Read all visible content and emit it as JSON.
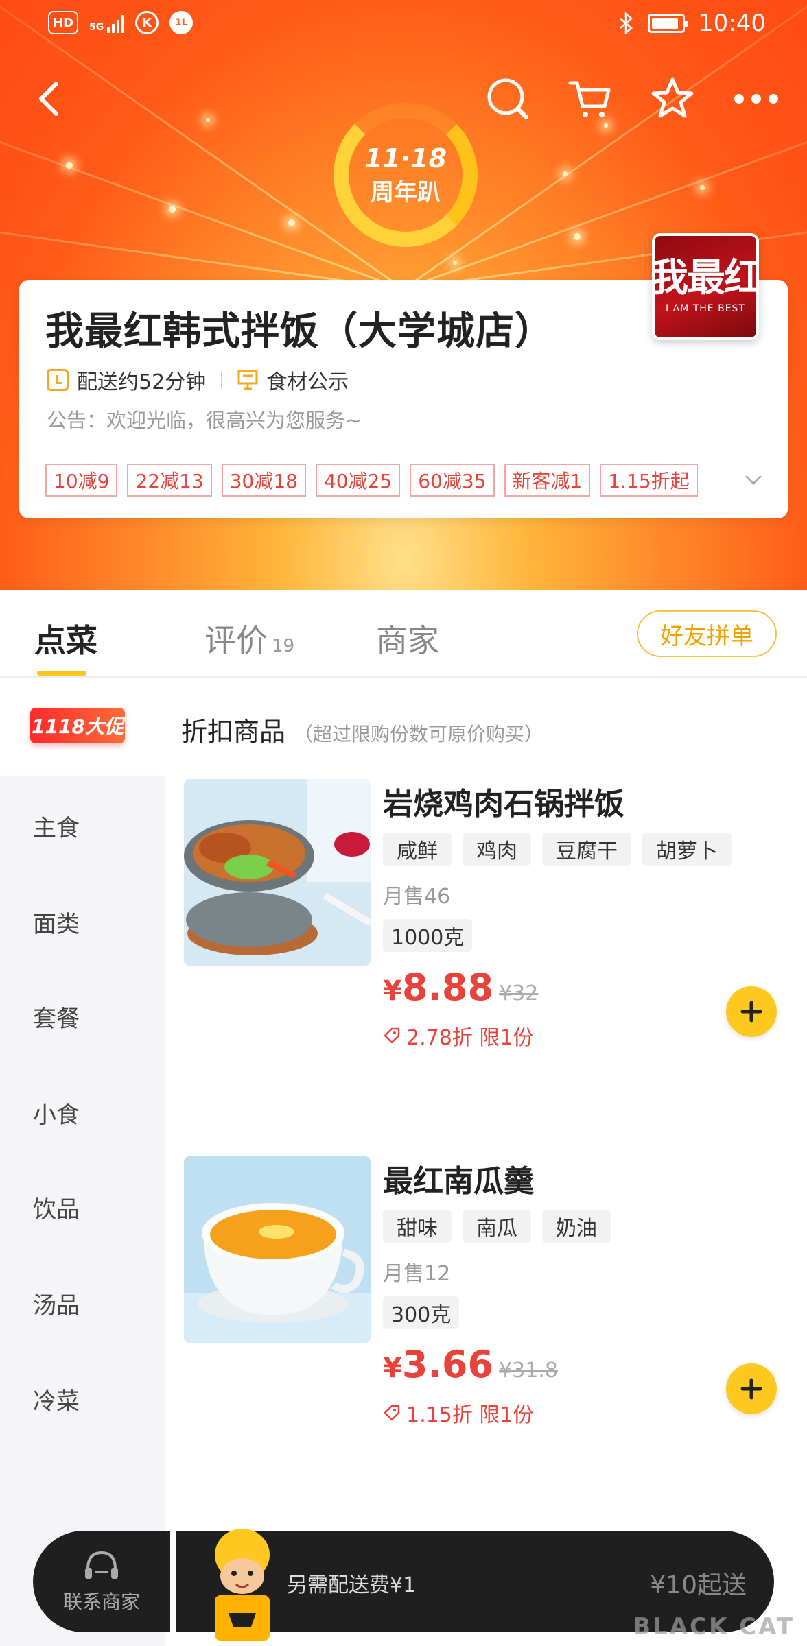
{
  "status_bar": {
    "left_icons": [
      "HD",
      "5G",
      "K",
      "1L"
    ],
    "time": "10:40",
    "battery_level": 0.9
  },
  "header": {
    "icons": [
      "back-icon",
      "search-icon",
      "cart-icon",
      "star-icon",
      "more-icon"
    ],
    "promo_logo_line1": "11·18",
    "promo_logo_line2": "周年趴",
    "colors": {
      "gradient_top": "#ff4a14",
      "gradient_center": "#ffb53a"
    }
  },
  "store": {
    "name": "我最红韩式拌饭（大学城店）",
    "delivery_time": "配送约52分钟",
    "ingredients_label": "食材公示",
    "notice": "公告：欢迎光临，很高兴为您服务~",
    "discount_tags": [
      "10减9",
      "22减13",
      "30减18",
      "40减25",
      "60减35",
      "新客减1",
      "1.15折起"
    ],
    "logo_text": "我最红",
    "logo_subtext": "I AM THE BEST"
  },
  "tabs": {
    "items": [
      {
        "label": "点菜",
        "count": ""
      },
      {
        "label": "评价",
        "count": "19"
      },
      {
        "label": "商家",
        "count": ""
      }
    ],
    "active": "点菜",
    "group_order_label": "好友拼单"
  },
  "promo_section": {
    "badge": "1118大促",
    "title": "折扣商品",
    "subtitle": "（超过限购份数可原价购买）"
  },
  "sidebar": {
    "categories": [
      "主食",
      "面类",
      "套餐",
      "小食",
      "饮品",
      "汤品",
      "冷菜"
    ]
  },
  "products": [
    {
      "name": "岩烧鸡肉石锅拌饭",
      "tags": [
        "咸鲜",
        "鸡肉",
        "豆腐干",
        "胡萝卜"
      ],
      "monthly_sales": "月售46",
      "spec": "1000克",
      "currency": "¥",
      "price": "8.88",
      "original_price": "¥32",
      "discount": "2.78折 限1份"
    },
    {
      "name": "最红南瓜羹",
      "tags": [
        "甜味",
        "南瓜",
        "奶油"
      ],
      "monthly_sales": "月售12",
      "spec": "300克",
      "currency": "¥",
      "price": "3.66",
      "original_price": "¥31.8",
      "discount": "1.15折 限1份"
    }
  ],
  "cart_bar": {
    "contact_label": "联系商家",
    "delivery_fee_note": "另需配送费¥1",
    "min_order": "¥10起送"
  },
  "watermark": "BLACK CAT"
}
